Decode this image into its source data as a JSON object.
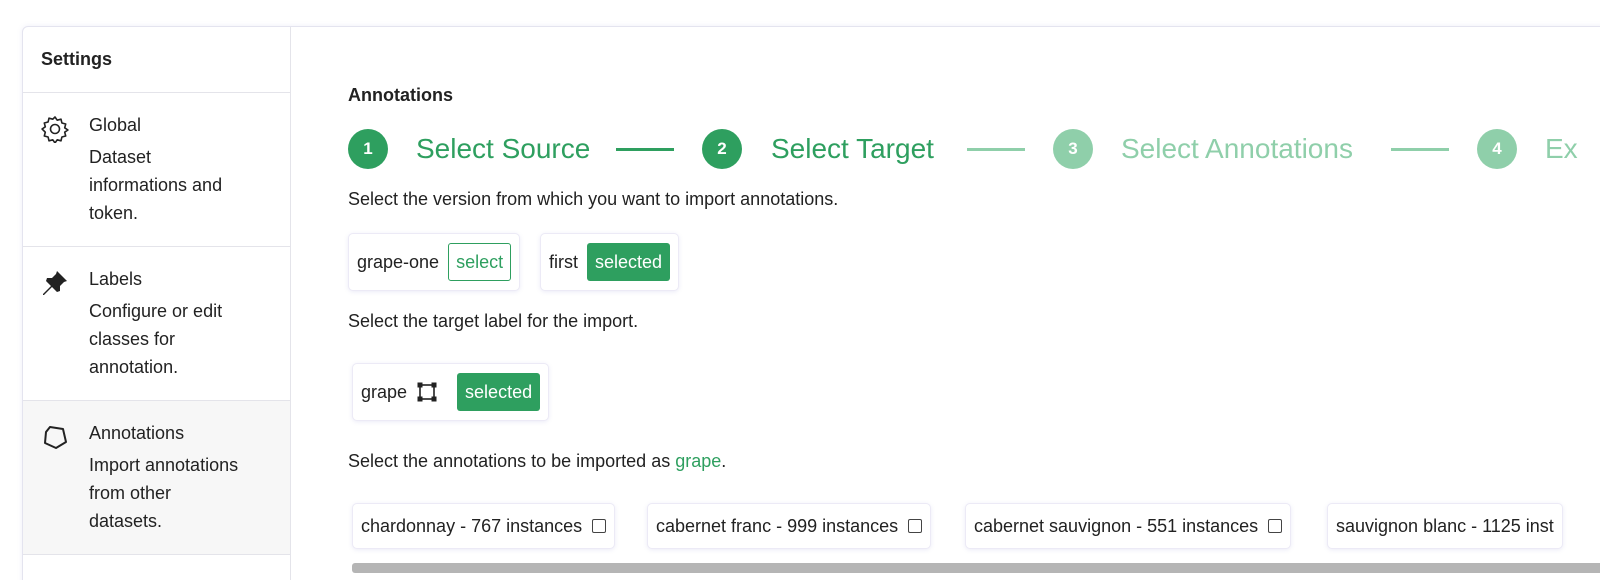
{
  "sidebar": {
    "title": "Settings",
    "items": [
      {
        "icon": "gear-icon",
        "label": "Global",
        "desc": "Dataset informations and token."
      },
      {
        "icon": "pin-icon",
        "label": "Labels",
        "desc": "Configure or edit classes for annotation."
      },
      {
        "icon": "polygon-icon",
        "label": "Annotations",
        "desc": "Import annotations from other datasets."
      }
    ]
  },
  "main": {
    "heading": "Annotations",
    "steps": [
      {
        "num": "1",
        "label": "Select Source"
      },
      {
        "num": "2",
        "label": "Select Target"
      },
      {
        "num": "3",
        "label": "Select Annotations"
      },
      {
        "num": "4",
        "label": "Ex"
      }
    ],
    "source_instruction": "Select the version from which you want to import annotations.",
    "versions": [
      {
        "name": "grape-one",
        "action": "select"
      },
      {
        "name": "first",
        "action": "selected"
      }
    ],
    "target_instruction": "Select the target label for the import.",
    "target_label": {
      "name": "grape",
      "action": "selected"
    },
    "annotations_instruction_prefix": "Select the annotations to be imported as ",
    "annotations_instruction_label": "grape",
    "annotations_instruction_suffix": ".",
    "annotation_options": [
      "chardonnay - 767 instances",
      "cabernet franc - 999 instances",
      "cabernet sauvignon - 551 instances",
      "sauvignon blanc - 1125 inst"
    ]
  },
  "colors": {
    "accent": "#2e9f5f",
    "accent_faded": "#8fcfaa"
  }
}
